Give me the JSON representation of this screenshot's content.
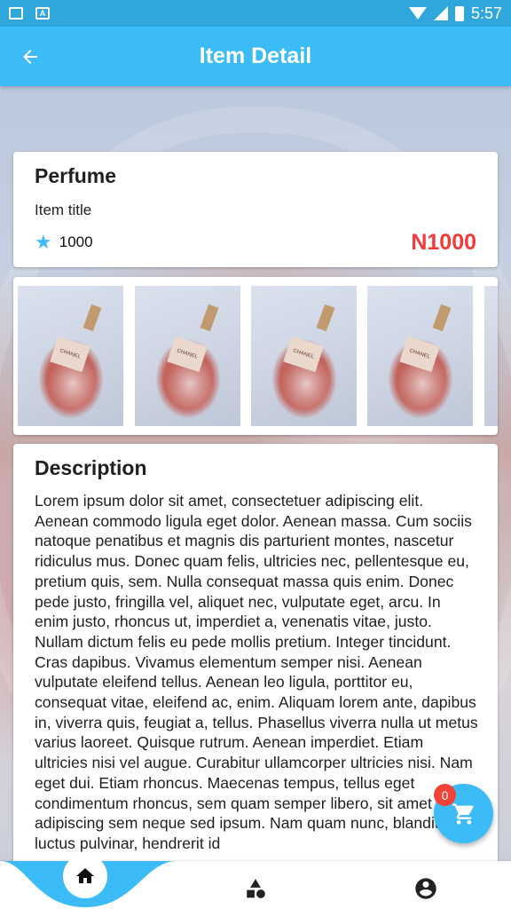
{
  "status_bar": {
    "time": "5:57"
  },
  "app_bar": {
    "title": "Item Detail"
  },
  "item": {
    "name": "Perfume",
    "subtitle": "Item title",
    "rating": "1000",
    "price": "N1000",
    "image_label": "CHANEL"
  },
  "gallery": {
    "thumbnails": 5
  },
  "description": {
    "title": "Description",
    "text": "Lorem ipsum dolor sit amet, consectetuer adipiscing elit. Aenean commodo ligula eget dolor. Aenean massa. Cum sociis natoque penatibus et magnis dis parturient montes, nascetur ridiculus mus. Donec quam felis, ultricies nec, pellentesque eu, pretium quis, sem. Nulla consequat massa quis enim. Donec pede justo, fringilla vel, aliquet nec, vulputate eget, arcu. In enim justo, rhoncus ut, imperdiet a, venenatis vitae, justo. Nullam dictum felis eu pede mollis pretium. Integer tincidunt. Cras dapibus. Vivamus elementum semper nisi. Aenean vulputate eleifend tellus. Aenean leo ligula, porttitor eu, consequat vitae, eleifend ac, enim. Aliquam lorem ante, dapibus in, viverra quis, feugiat a, tellus. Phasellus viverra nulla ut metus varius laoreet. Quisque rutrum. Aenean imperdiet. Etiam ultricies nisi vel augue. Curabitur ullamcorper ultricies nisi. Nam eget dui. Etiam rhoncus. Maecenas tempus, tellus eget condimentum rhoncus, sem quam semper libero, sit amet adipiscing sem neque sed ipsum. Nam quam nunc, blandit vel, luctus pulvinar, hendrerit id"
  },
  "cart": {
    "count": "0"
  },
  "bottom_nav": {
    "items": [
      "home-icon",
      "shapes-icon",
      "account-icon"
    ]
  },
  "colors": {
    "primary": "#3cbcf7",
    "status_bar": "#2fa7dd",
    "price": "#f23a3a",
    "badge": "#f44336"
  }
}
